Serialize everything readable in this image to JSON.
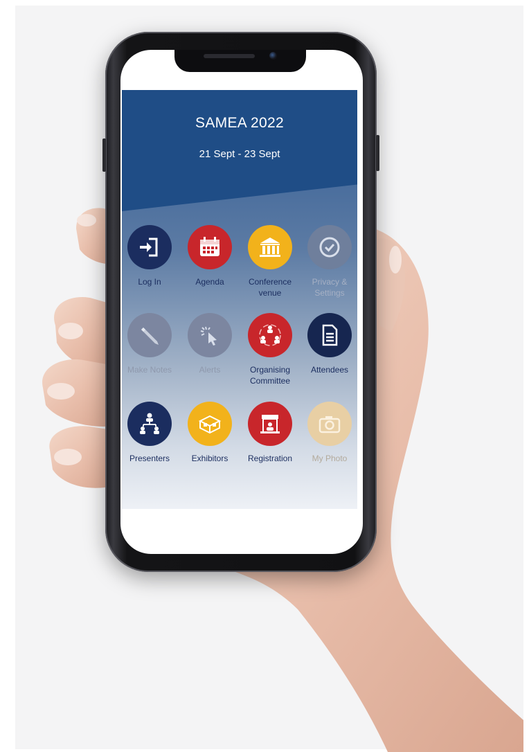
{
  "app": {
    "title": "SAMEA 2022",
    "dates": "21 Sept - 23 Sept"
  },
  "colors": {
    "header": "#1f4d86",
    "navy": "#1b2d5f",
    "red": "#c8262b",
    "yellow": "#f2b21b",
    "disabled": "#7f8aa3",
    "label_active": "#1b2d5f",
    "label_disabled": "#8f99ad"
  },
  "tiles": [
    {
      "label": "Log In",
      "icon": "login-icon",
      "state": "active"
    },
    {
      "label": "Agenda",
      "icon": "calendar-icon",
      "state": "active"
    },
    {
      "label": "Conference venue",
      "icon": "building-icon",
      "state": "active"
    },
    {
      "label": "Privacy & Settings",
      "icon": "check-circle-icon",
      "state": "disabled"
    },
    {
      "label": "Make Notes",
      "icon": "pencil-icon",
      "state": "disabled"
    },
    {
      "label": "Alerts",
      "icon": "cursor-click-icon",
      "state": "disabled"
    },
    {
      "label": "Organising Committee",
      "icon": "team-cycle-icon",
      "state": "active"
    },
    {
      "label": "Attendees",
      "icon": "document-icon",
      "state": "active"
    },
    {
      "label": "Presenters",
      "icon": "org-chart-icon",
      "state": "active"
    },
    {
      "label": "Exhibitors",
      "icon": "exhibition-booth-icon",
      "state": "active"
    },
    {
      "label": "Registration",
      "icon": "registration-desk-icon",
      "state": "active"
    },
    {
      "label": "My Photo",
      "icon": "camera-icon",
      "state": "disabled"
    }
  ]
}
